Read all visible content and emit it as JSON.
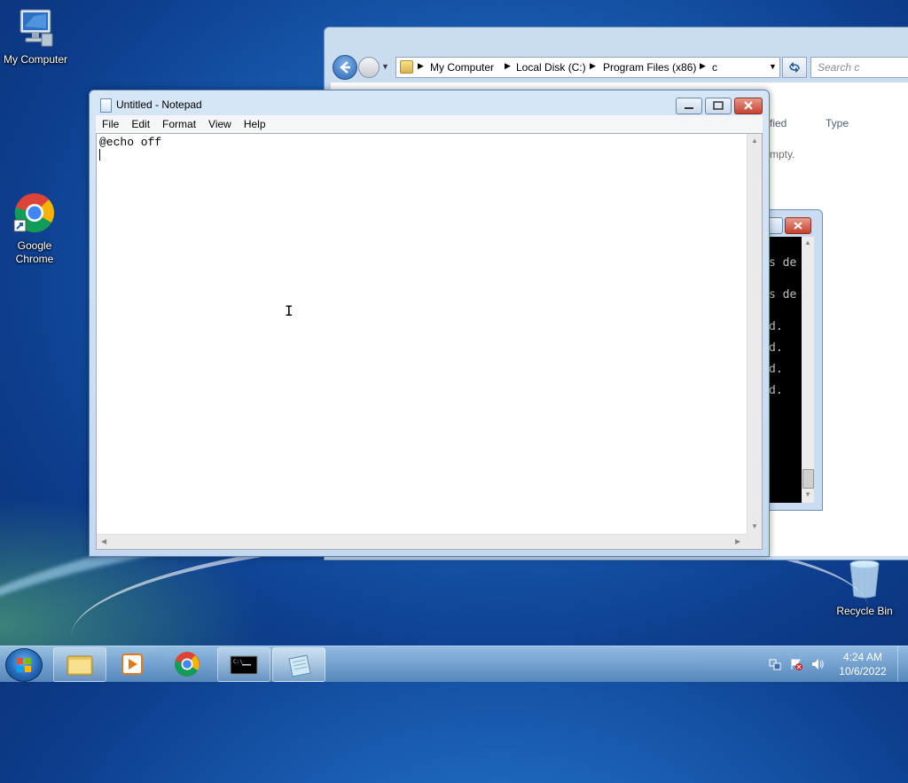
{
  "desktop": {
    "icons": [
      {
        "label": "My Computer"
      },
      {
        "label": "Google Chrome"
      },
      {
        "label": "Recycle Bin"
      }
    ]
  },
  "explorer": {
    "breadcrumb": [
      "My Computer",
      "Local Disk (C:)",
      "Program Files (x86)",
      "c"
    ],
    "search_placeholder": "Search c",
    "column_modified_partial": "fied",
    "column_type": "Type",
    "empty_partial": "mpty."
  },
  "cmd": {
    "lines": [
      "s de",
      "s de",
      "d.",
      "d.",
      "d.",
      "d."
    ]
  },
  "notepad": {
    "title": "Untitled - Notepad",
    "menu": [
      "File",
      "Edit",
      "Format",
      "View",
      "Help"
    ],
    "content_line1": "@echo off"
  },
  "taskbar": {
    "time": "4:24 AM",
    "date": "10/6/2022"
  }
}
